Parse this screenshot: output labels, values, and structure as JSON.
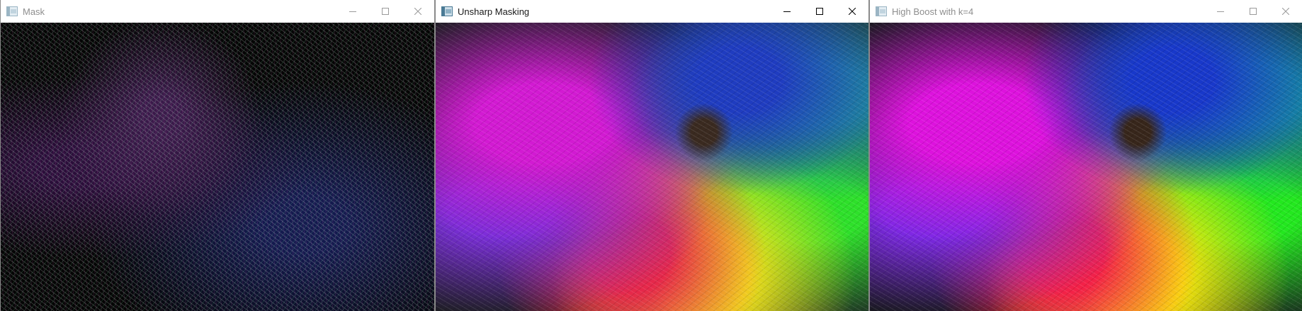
{
  "windows": [
    {
      "title": "Mask",
      "active": false,
      "image": "edge-mask-flower"
    },
    {
      "title": "Unsharp Masking",
      "active": true,
      "image": "unsharp-masked-flower"
    },
    {
      "title": "High Boost with k=4",
      "active": false,
      "image": "high-boost-flower"
    }
  ],
  "controls": {
    "minimize_icon": "minimize-icon",
    "maximize_icon": "maximize-icon",
    "close_icon": "close-icon"
  }
}
